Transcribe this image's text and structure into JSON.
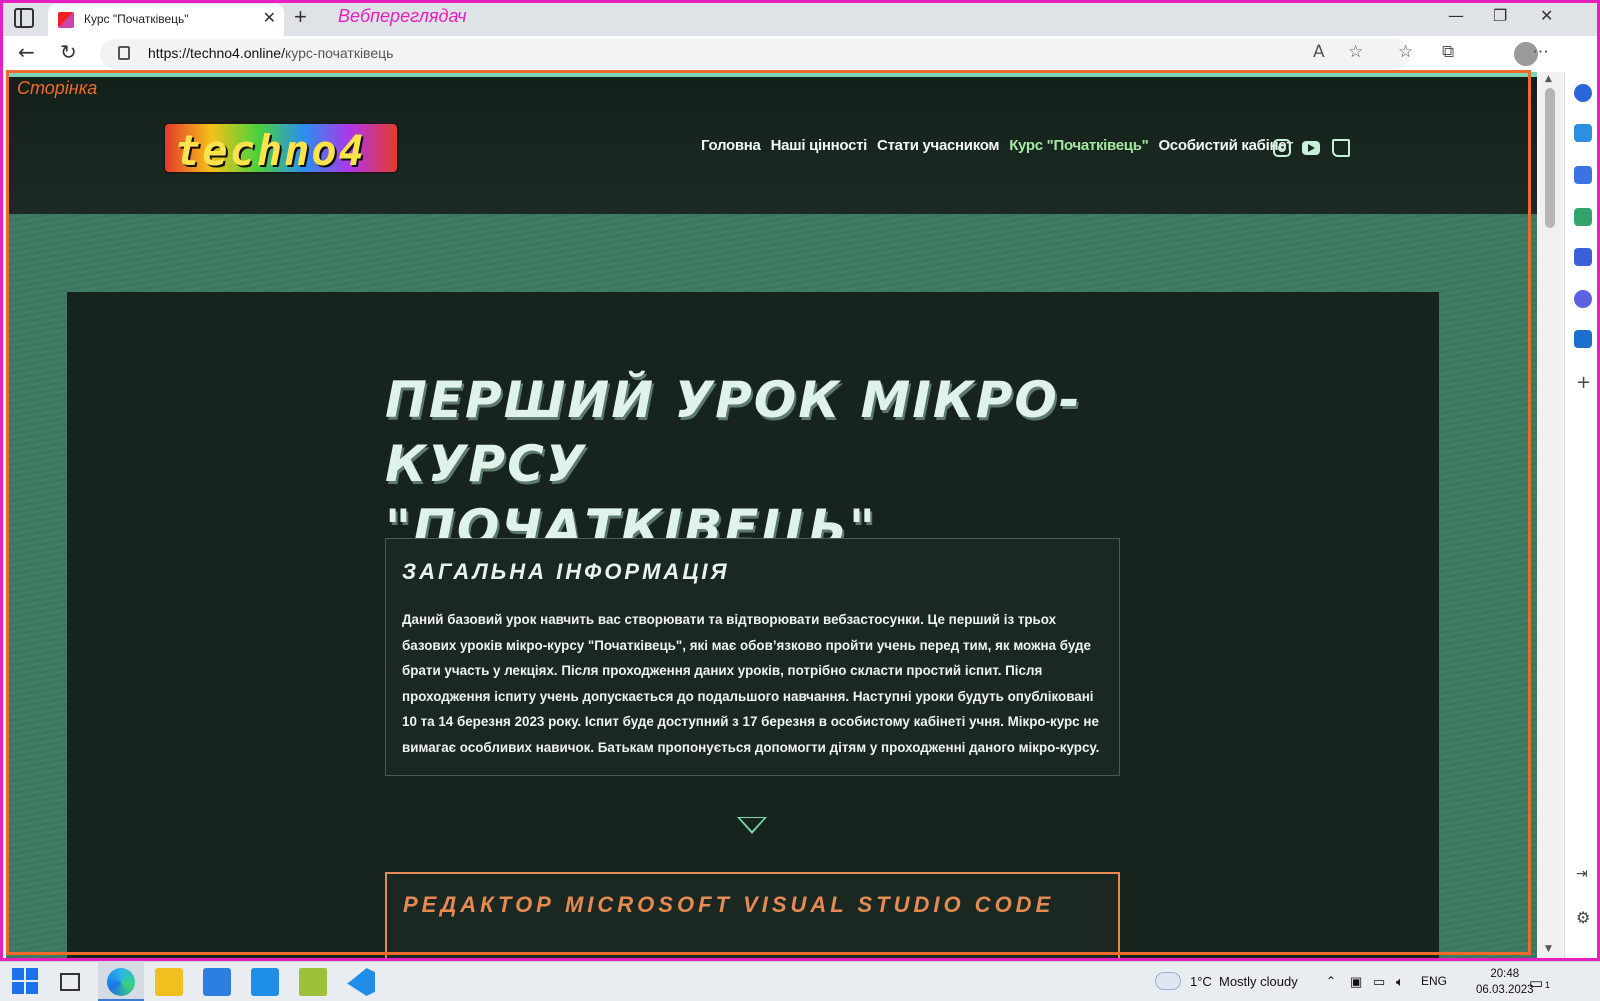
{
  "browser": {
    "tab_title": "Курс \"Початківець\"",
    "tab_close": "✕",
    "new_tab": "+",
    "annotation_label": "Вебпереглядач",
    "url_host": "https://techno4.online/",
    "url_path": "курс-початківець",
    "window_controls": {
      "minimize": "—",
      "maximize": "❐",
      "close": "✕"
    }
  },
  "page": {
    "annotation_label": "Сторінка",
    "logo_text": "techno4",
    "nav": [
      {
        "label": "Головна",
        "active": false
      },
      {
        "label": "Наші цінності",
        "active": false
      },
      {
        "label": "Стати учасником",
        "active": false
      },
      {
        "label": "Курс \"Початківець\"",
        "active": true
      },
      {
        "label": "Особистий кабінет",
        "active": false
      }
    ],
    "social_icons": [
      "instagram-icon",
      "youtube-icon",
      "twitch-icon"
    ],
    "title": "ПЕРШИЙ УРОК МІКРО-КУРСУ \"ПОЧАТКІВЕЦЬ\"",
    "info_card": {
      "heading": "ЗАГАЛЬНА ІНФОРМАЦІЯ",
      "body": "Даний базовий урок навчить вас створювати та відтворювати вебзастосунки. Це перший із трьох базових уроків мікро-курсу \"Початківець\", які має обов’язково пройти учень перед тим, як можна буде брати участь у лекціях. Після проходження даних уроків, потрібно скласти простий іспит. Після проходження іспиту учень допускається до подальшого навчання. Наступні уроки будуть опубліковані 10 та 14 березня 2023 року. Іспит буде доступний з 17 березня в особистому кабінеті учня. Мікро-курс не вимагає особливих навичок. Батькам пропонується допомогти дітям у проходженні даного мікро-курсу."
    },
    "vs_card": {
      "heading": "РЕДАКТОР MICROSOFT VISUAL STUDIO CODE"
    }
  },
  "taskbar": {
    "weather_temp": "1°C",
    "weather_text": "Mostly cloudy",
    "language": "ENG",
    "time": "20:48",
    "date": "06.03.2023",
    "notification_count": "1"
  },
  "colors": {
    "page_bg": "#3d7a63",
    "content_bg": "#17231d",
    "accent_orange": "#e48a52",
    "nav_active": "#a6e8a2",
    "annotation_pink": "#e61fbf",
    "annotation_orange": "#ee6a2a"
  }
}
